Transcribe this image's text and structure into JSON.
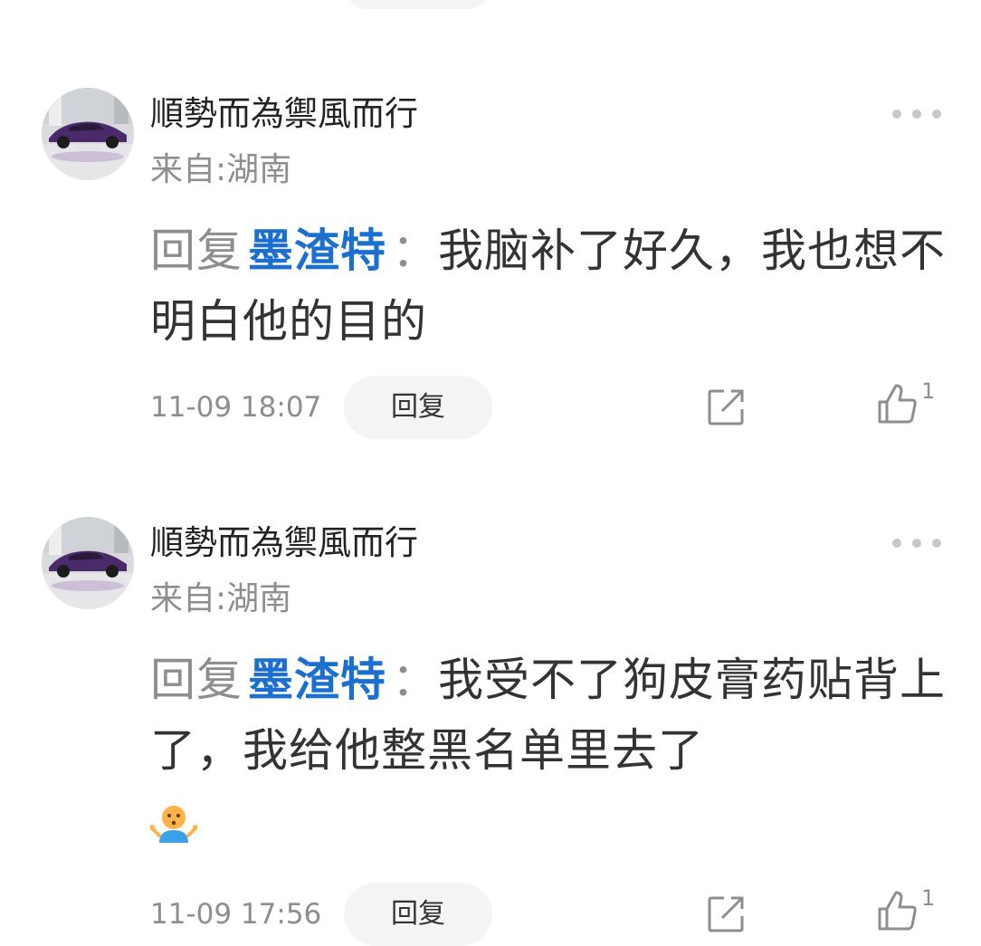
{
  "comments": [
    {
      "username": "順勢而為禦風而行",
      "location": "来自:湖南",
      "reply_prefix": "回复",
      "mention": "墨渣特",
      "separator": "：",
      "text": "我脑补了好久，我也想不明白他的目的",
      "emoji": "",
      "timestamp": "11-09 18:07",
      "reply_label": "回复",
      "like_count": "1"
    },
    {
      "username": "順勢而為禦風而行",
      "location": "来自:湖南",
      "reply_prefix": "回复",
      "mention": "墨渣特",
      "separator": "：",
      "text": "我受不了狗皮膏药贴背上了，我给他整黑名单里去了",
      "emoji": "shrug-person-emoji",
      "timestamp": "11-09 17:56",
      "reply_label": "回复",
      "like_count": "1"
    }
  ],
  "colors": {
    "mention": "#1a6fd1",
    "muted": "#8e8e8e",
    "text": "#333333",
    "pill": "#f3f4f6"
  }
}
